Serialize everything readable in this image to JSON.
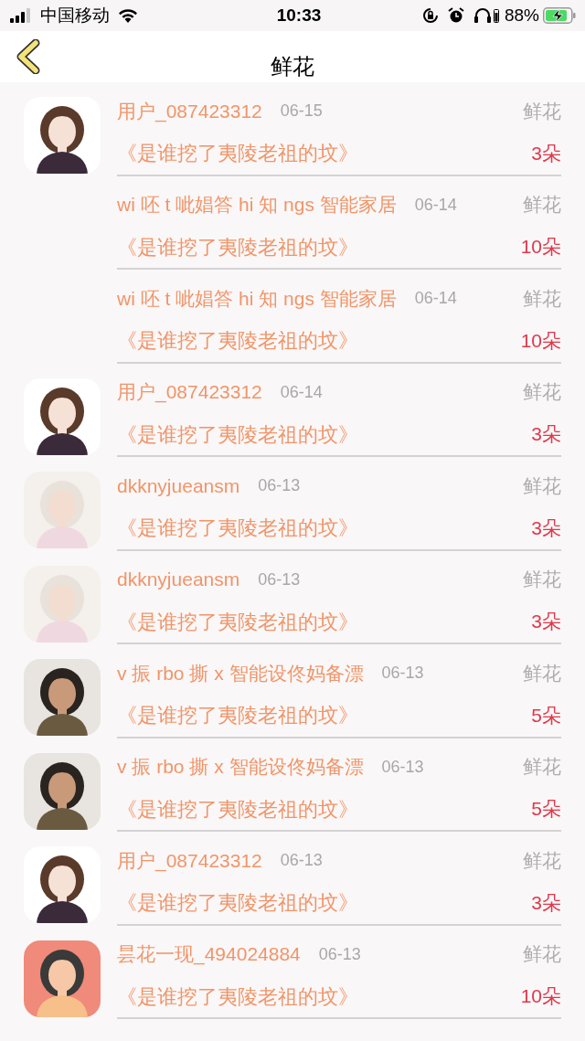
{
  "status_bar": {
    "carrier": "中国移动",
    "time": "10:33",
    "battery": "88%"
  },
  "nav": {
    "title": "鲜花"
  },
  "rows": [
    {
      "name": "用户_087423312",
      "date": "06-15",
      "gift": "鲜花",
      "book": "《是谁挖了夷陵老祖的坟》",
      "count": "3朵"
    },
    {
      "name": "wi 呸 t 呲娼答 hi 知 ngs 智能家居",
      "date": "06-14",
      "gift": "鲜花",
      "book": "《是谁挖了夷陵老祖的坟》",
      "count": "10朵"
    },
    {
      "name": "wi 呸 t 呲娼答 hi 知 ngs 智能家居",
      "date": "06-14",
      "gift": "鲜花",
      "book": "《是谁挖了夷陵老祖的坟》",
      "count": "10朵"
    },
    {
      "name": "用户_087423312",
      "date": "06-14",
      "gift": "鲜花",
      "book": "《是谁挖了夷陵老祖的坟》",
      "count": "3朵"
    },
    {
      "name": "dkknyjueansm",
      "date": "06-13",
      "gift": "鲜花",
      "book": "《是谁挖了夷陵老祖的坟》",
      "count": "3朵"
    },
    {
      "name": "dkknyjueansm",
      "date": "06-13",
      "gift": "鲜花",
      "book": "《是谁挖了夷陵老祖的坟》",
      "count": "3朵"
    },
    {
      "name": "v 振 rbo 撕 x 智能设佟妈备漂",
      "date": "06-13",
      "gift": "鲜花",
      "book": "《是谁挖了夷陵老祖的坟》",
      "count": "5朵"
    },
    {
      "name": "v 振 rbo 撕 x 智能设佟妈备漂",
      "date": "06-13",
      "gift": "鲜花",
      "book": "《是谁挖了夷陵老祖的坟》",
      "count": "5朵"
    },
    {
      "name": "用户_087423312",
      "date": "06-13",
      "gift": "鲜花",
      "book": "《是谁挖了夷陵老祖的坟》",
      "count": "3朵"
    },
    {
      "name": "昙花一现_494024884",
      "date": "06-13",
      "gift": "鲜花",
      "book": "《是谁挖了夷陵老祖的坟》",
      "count": "10朵"
    }
  ]
}
